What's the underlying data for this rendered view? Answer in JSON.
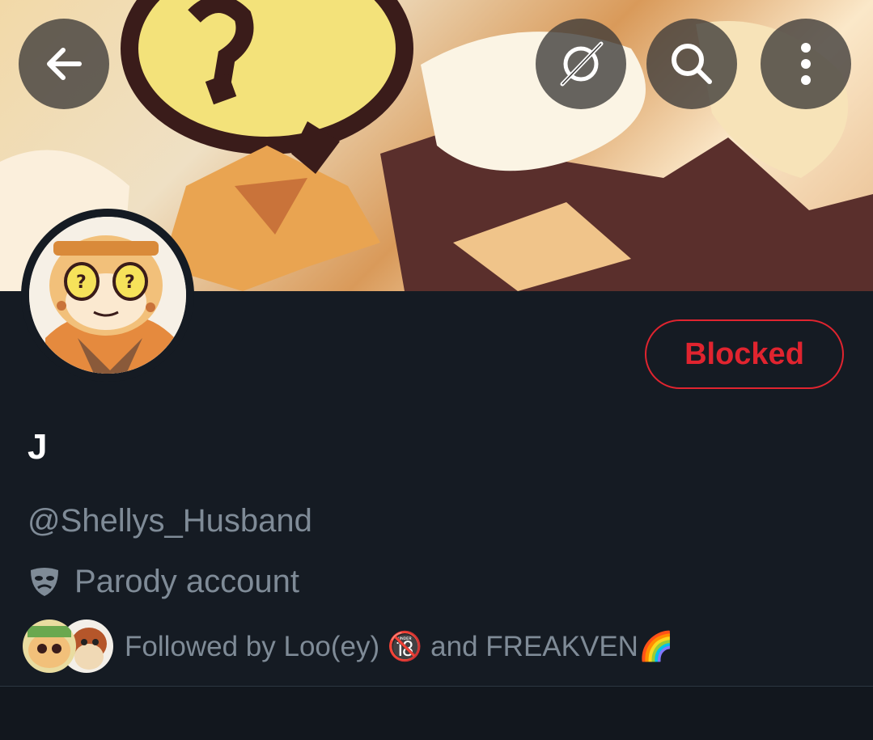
{
  "header": {
    "back_icon": "arrow-left-icon",
    "translate_icon": "grok-icon",
    "search_icon": "search-icon",
    "more_icon": "more-vertical-icon"
  },
  "profile": {
    "action_button": "Blocked",
    "display_name": "J",
    "handle": "@Shellys_Husband",
    "label": "Parody account",
    "label_icon": "theater-masks-icon",
    "followed_by": "Followed by Loo(ey) 🔞 and FREAKVEN🌈"
  },
  "colors": {
    "background": "#151b23",
    "blocked_red": "#e0242f",
    "muted_text": "#7f8b97"
  }
}
